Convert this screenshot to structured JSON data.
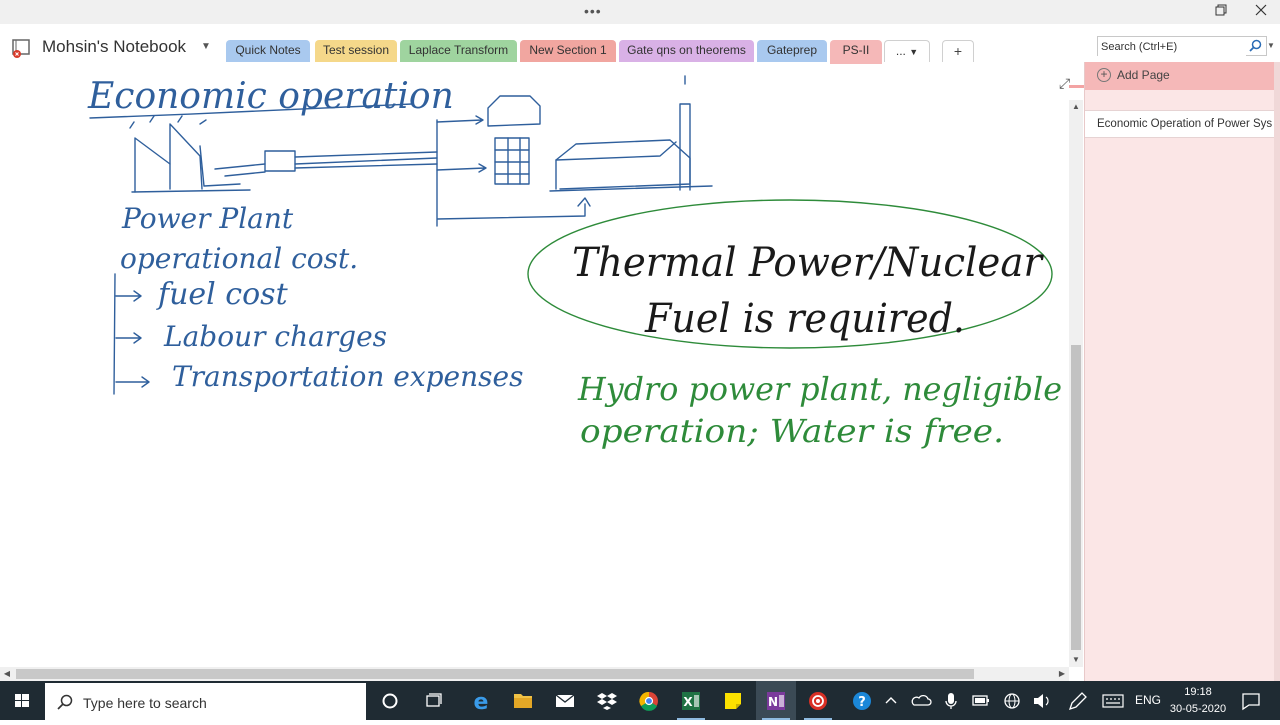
{
  "titlebar": {
    "dots": "•••"
  },
  "notebook": {
    "name": "Mohsin's Notebook"
  },
  "sections": [
    {
      "label": "Quick Notes",
      "color": "#a9c9ef"
    },
    {
      "label": "Test session",
      "color": "#f5d88a"
    },
    {
      "label": "Laplace Transform",
      "color": "#9fd49f"
    },
    {
      "label": "New Section 1",
      "color": "#f1a6a0"
    },
    {
      "label": "Gate qns on theorems",
      "color": "#d9b1e6"
    },
    {
      "label": "Gateprep",
      "color": "#a9c9ef"
    },
    {
      "label": "PS-II",
      "color": "#f5b8b8"
    }
  ],
  "tab_more": "...",
  "tab_add": "+",
  "search": {
    "placeholder": "Search (Ctrl+E)"
  },
  "page_panel": {
    "add_page": "Add Page",
    "pages": [
      "Economic Operation of Power Sys"
    ]
  },
  "taskbar": {
    "search_placeholder": "Type here to search",
    "language": "ENG",
    "time": "19:18",
    "date": "30-05-2020"
  },
  "colors": {
    "accent": "#f3a3a3",
    "ink_blue": "#2f5f9c",
    "ink_black": "#1a1a1a",
    "ink_green": "#2e8b3a",
    "taskbar": "#1f2b33"
  },
  "ink": {
    "title": "Economic operation",
    "plant_label_1": "Power Plant",
    "plant_label_2": "operational cost.",
    "cost_items": [
      "fuel cost",
      "Labour charges",
      "Transportation expenses"
    ],
    "thermal_line_1": "Thermal Power/Nuclear",
    "thermal_line_2": "Fuel is required.",
    "hydro_line_1": "Hydro power plant, negligible",
    "hydro_line_2": "operation; Water is free."
  }
}
